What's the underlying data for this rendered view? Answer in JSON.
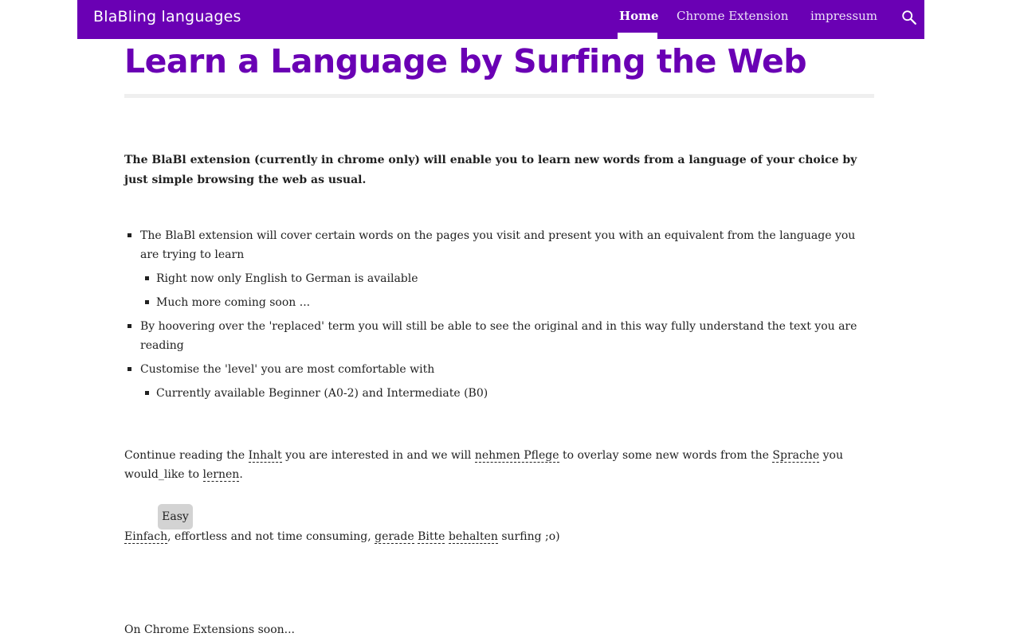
{
  "header": {
    "site_name": "BlaBling languages",
    "nav": [
      {
        "label": "Home",
        "active": true
      },
      {
        "label": "Chrome Extension",
        "active": false
      },
      {
        "label": "impressum",
        "active": false
      }
    ],
    "search_icon": "search-icon"
  },
  "main": {
    "title": "Learn a Language by Surfing the Web",
    "intro": "The BlaBl extension (currently in chrome only) will enable you to learn new words from a language of your choice by just simple browsing the web as usual.",
    "bullets": {
      "b1_line1": "The BlaBl extension will cover certain words on the pages you visit and present you with an equivalent from the language you",
      "b1_line2": "are trying to learn",
      "b1_sub1": "Right now only English to German is available",
      "b1_sub2": "Much more coming soon ...",
      "b2_line1": "By hoovering over the 'replaced' term you will still be able to see the original and in this way fully understand the text you are",
      "b2_line2": "reading",
      "b3": "Customise the 'level' you are most comfortable with",
      "b3_sub1": "Currently available Beginner (A0-2) and Intermediate (B0)"
    },
    "para1": {
      "t1": "Continue reading the ",
      "w1": "Inhalt",
      "t2": " you are interested in and we will ",
      "w2": "nehmen Pflege",
      "t3": " to overlay some new words from the ",
      "w3": "Sprache",
      "t4": " you",
      "t5": "would_like to ",
      "w4": "lernen",
      "t6": "."
    },
    "tooltip": "Easy",
    "para2": {
      "w1": "Einfach",
      "t1": ", effortless and not time consuming, ",
      "w2": "gerade",
      "w3": "Bitte",
      "w4": "behalten",
      "t2": " surfing ;o)"
    },
    "footer_text": "On Chrome Extensions soon..."
  },
  "colors": {
    "brand": "#6a00b4",
    "text": "#212121",
    "tooltip_bg": "#d3d3d3"
  }
}
